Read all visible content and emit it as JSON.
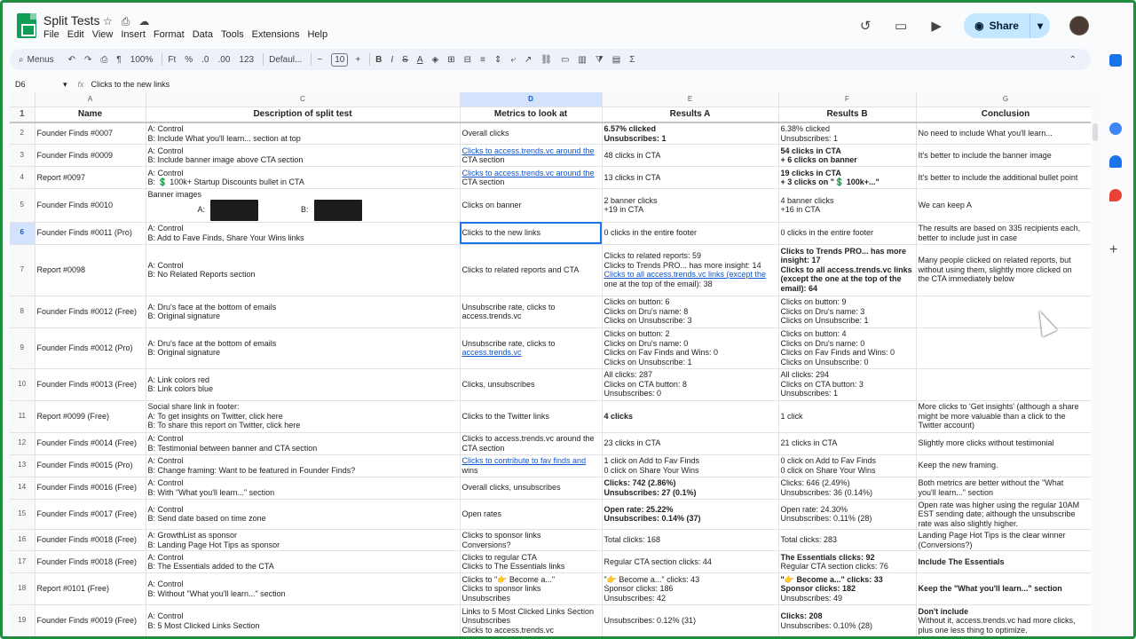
{
  "title": "Split Tests",
  "menu": [
    "File",
    "Edit",
    "View",
    "Insert",
    "Format",
    "Data",
    "Tools",
    "Extensions",
    "Help"
  ],
  "share_label": "Share",
  "toolbar": {
    "menus": "Menus",
    "zoom": "100%",
    "currency": "Ft",
    "percent": "%",
    "dec_dec": ".0",
    "dec_inc": ".00",
    "format_123": "123",
    "font": "Defaul...",
    "font_size": "10",
    "bold": "B",
    "italic": "I",
    "strike": "S",
    "textcolor": "A"
  },
  "formula_bar": {
    "cell": "D6",
    "value": "Clicks to the new links"
  },
  "columns": [
    "A",
    "C",
    "D",
    "E",
    "F",
    "G"
  ],
  "header_row": [
    "Name",
    "Description of split test",
    "Metrics to look at",
    "Results A",
    "Results B",
    "Conclusion"
  ],
  "rows": [
    {
      "n": "2",
      "a": "Founder Finds #0007",
      "c": [
        "A: Control",
        "B: Include What you'll learn... section at top"
      ],
      "d": [
        "Overall clicks"
      ],
      "e": [
        "6.57% clicked",
        "Unsubscribes: 1"
      ],
      "f": [
        "6.38% clicked",
        "Unsubscribes: 1"
      ],
      "g": [
        "No need to include What you'll learn..."
      ]
    },
    {
      "n": "3",
      "a": "Founder Finds #0009",
      "c": [
        "A: Control",
        "B: Include banner image above CTA section"
      ],
      "d": [
        "Clicks to access.trends.vc around the",
        "CTA section"
      ],
      "e": [
        "48 clicks in CTA"
      ],
      "f": [
        "54 clicks in CTA",
        "+ 6 clicks on banner"
      ],
      "g": [
        "It's better to include the banner image"
      ]
    },
    {
      "n": "4",
      "a": "Report #0097",
      "c": [
        "A: Control",
        "B: 💲 100k+ Startup Discounts bullet in CTA"
      ],
      "d": [
        "Clicks to access.trends.vc around the",
        "CTA section"
      ],
      "e": [
        "13 clicks in CTA"
      ],
      "f": [
        "19 clicks in CTA",
        "+ 3 clicks on \"💲 100k+...\""
      ],
      "g": [
        "It's better to include the additional bullet point"
      ]
    },
    {
      "n": "5",
      "a": "Founder Finds #0010",
      "c": [
        "Banner images",
        "A:",
        "B:"
      ],
      "d": [
        "Clicks on banner"
      ],
      "e": [
        "2 banner clicks",
        "+19 in CTA"
      ],
      "f": [
        "4 banner clicks",
        "+16 in CTA"
      ],
      "g": [
        "We can keep A"
      ]
    },
    {
      "n": "6",
      "a": "Founder Finds #0011 (Pro)",
      "c": [
        "A: Control",
        "B: Add to Fave Finds, Share Your Wins links"
      ],
      "d": [
        "Clicks to the new links"
      ],
      "e": [
        "0 clicks in the entire footer"
      ],
      "f": [
        "0 clicks in the entire footer"
      ],
      "g": [
        "The results are based on 335 recipients each,",
        "better to include just in case"
      ]
    },
    {
      "n": "7",
      "a": "Report #0098",
      "c": [
        "A: Control",
        "B: No Related Reports section"
      ],
      "d": [
        "Clicks to related reports and CTA"
      ],
      "e": [
        "Clicks to related reports: 59",
        "Clicks to Trends PRO... has more insight: 14",
        "Clicks to all access.trends.vc links (except the",
        "one at the top of the email): 38"
      ],
      "f": [
        "Clicks to Trends PRO... has more",
        "insight: 17",
        "Clicks to all access.trends.vc links",
        "(except the one at the top of the",
        "email): 64"
      ],
      "g": [
        "Many people clicked on related reports, but",
        "without using them, slightly more clicked on",
        "the CTA immediately below"
      ]
    },
    {
      "n": "8",
      "a": "Founder Finds #0012 (Free)",
      "c": [
        "A: Dru's face at the bottom of emails",
        "B: Original signature"
      ],
      "d": [
        "Unsubscribe rate, clicks to",
        "access.trends.vc"
      ],
      "e": [
        "Clicks on button: 6",
        "Clicks on Dru's name: 8",
        "Clicks on Unsubscribe: 3"
      ],
      "f": [
        "Clicks on button: 9",
        "Clicks on Dru's name: 3",
        "Clicks on Unsubscribe: 1"
      ],
      "g": []
    },
    {
      "n": "9",
      "a": "Founder Finds #0012 (Pro)",
      "c": [
        "A: Dru's face at the bottom of emails",
        "B: Original signature"
      ],
      "d": [
        "Unsubscribe rate, clicks to",
        "access.trends.vc"
      ],
      "e": [
        "Clicks on button: 2",
        "Clicks on Dru's name: 0",
        "Clicks on Fav Finds and Wins: 0",
        "Clicks on Unsubscribe: 1"
      ],
      "f": [
        "Clicks on button: 4",
        "Clicks on Dru's name: 0",
        "Clicks on Fav Finds and Wins: 0",
        "Clicks on Unsubscribe: 0"
      ],
      "g": []
    },
    {
      "n": "10",
      "a": "Founder Finds #0013 (Free)",
      "c": [
        "A: Link colors red",
        "B: Link colors blue"
      ],
      "d": [
        "Clicks, unsubscribes"
      ],
      "e": [
        "All clicks: 287",
        "Clicks on CTA button: 8",
        "Unsubscribes: 0"
      ],
      "f": [
        "All clicks: 294",
        "Clicks on CTA button: 3",
        "Unsubscribes: 1"
      ],
      "g": []
    },
    {
      "n": "11",
      "a": "Report #0099 (Free)",
      "c": [
        "Social share link in footer:",
        "A: To get insights on Twitter, click here",
        "B: To share this report on Twitter, click here"
      ],
      "d": [
        "Clicks to the Twitter links"
      ],
      "e": [
        "4 clicks"
      ],
      "f": [
        "1 click"
      ],
      "g": [
        "More clicks to 'Get insights' (although a share",
        "might be more valuable than a click to the",
        "Twitter account)"
      ]
    },
    {
      "n": "12",
      "a": "Founder Finds #0014 (Free)",
      "c": [
        "A: Control",
        "B: Testimonial between banner and CTA section"
      ],
      "d": [
        "Clicks to access.trends.vc around the",
        "CTA section"
      ],
      "e": [
        "23 clicks in CTA"
      ],
      "f": [
        "21 clicks in CTA"
      ],
      "g": [
        "Slightly more clicks without testimonial"
      ]
    },
    {
      "n": "13",
      "a": "Founder Finds #0015 (Pro)",
      "c": [
        "A: Control",
        "B: Change framing: Want to be featured in Founder Finds?"
      ],
      "d": [
        "Clicks to contribute to fav finds and",
        "wins"
      ],
      "e": [
        "1 click on Add to Fav Finds",
        "0 click on Share Your Wins"
      ],
      "f": [
        "0 click on Add to Fav Finds",
        "0 click on Share Your Wins"
      ],
      "g": [
        "Keep the new framing."
      ]
    },
    {
      "n": "14",
      "a": "Founder Finds #0016 (Free)",
      "c": [
        "A: Control",
        "B: With \"What you'll learn...\" section"
      ],
      "d": [
        "Overall clicks, unsubscribes"
      ],
      "e": [
        "Clicks: 742 (2.86%)",
        "Unsubscribes: 27 (0.1%)"
      ],
      "f": [
        "Clicks: 646 (2.49%)",
        "Unsubscribes: 36 (0.14%)"
      ],
      "g": [
        "Both metrics are better without the \"What",
        "you'll learn...\" section"
      ]
    },
    {
      "n": "15",
      "a": "Founder Finds #0017 (Free)",
      "c": [
        "A: Control",
        "B: Send date based on time zone"
      ],
      "d": [
        "Open rates"
      ],
      "e": [
        "Open rate: 25.22%",
        "Unsubscribes: 0.14% (37)"
      ],
      "f": [
        "Open rate: 24.30%",
        "Unsubscribes: 0.11% (28)"
      ],
      "g": [
        "Open rate was higher using the regular 10AM",
        "EST sending date; although the unsubscribe",
        "rate was also slightly higher."
      ]
    },
    {
      "n": "16",
      "a": "Founder Finds #0018 (Free)",
      "c": [
        "A: GrowthList as sponsor",
        "B: Landing Page Hot Tips as sponsor"
      ],
      "d": [
        "Clicks to sponsor links",
        "Conversions?"
      ],
      "e": [
        "Total clicks: 168"
      ],
      "f": [
        "Total clicks: 283"
      ],
      "g": [
        "Landing Page Hot Tips is the clear winner",
        "(Conversions?)"
      ]
    },
    {
      "n": "17",
      "a": "Founder Finds #0018 (Free)",
      "c": [
        "A: Control",
        "B: The Essentials added to the CTA"
      ],
      "d": [
        "Clicks to regular CTA",
        "Clicks to The Essentials links"
      ],
      "e": [
        "Regular CTA section clicks: 44"
      ],
      "f": [
        "The Essentials clicks: 92",
        "Regular CTA section clicks: 76"
      ],
      "g": [
        "Include The Essentials"
      ]
    },
    {
      "n": "18",
      "a": "Report #0101 (Free)",
      "c": [
        "A: Control",
        "B: Without \"What you'll learn...\" section"
      ],
      "d": [
        "Clicks to \"👉 Become a...\"",
        "Clicks to sponsor links",
        "Unsubscribes"
      ],
      "e": [
        "\"👉 Become a...\" clicks: 43",
        "Sponsor clicks: 186",
        "Unsubscribes: 42"
      ],
      "f": [
        "\"👉 Become a...\" clicks: 33",
        "Sponsor clicks: 182",
        "Unsubscribes: 49"
      ],
      "g": [
        "Keep the \"What you'll learn...\" section"
      ]
    },
    {
      "n": "19",
      "a": "Founder Finds #0019 (Free)",
      "c": [
        "A: Control",
        "B: 5 Most Clicked Links Section"
      ],
      "d": [
        "Links to 5 Most Clicked Links Section",
        "Unsubscribes",
        "Clicks to access.trends.vc"
      ],
      "e": [
        "Unsubscribes: 0.12% (31)"
      ],
      "f": [
        "Clicks: 208",
        "Unsubscribes: 0.10% (28)"
      ],
      "g": [
        "Don't include",
        "Without it, access.trends.vc had more clicks,",
        "plus one less thing to optimize."
      ]
    }
  ]
}
